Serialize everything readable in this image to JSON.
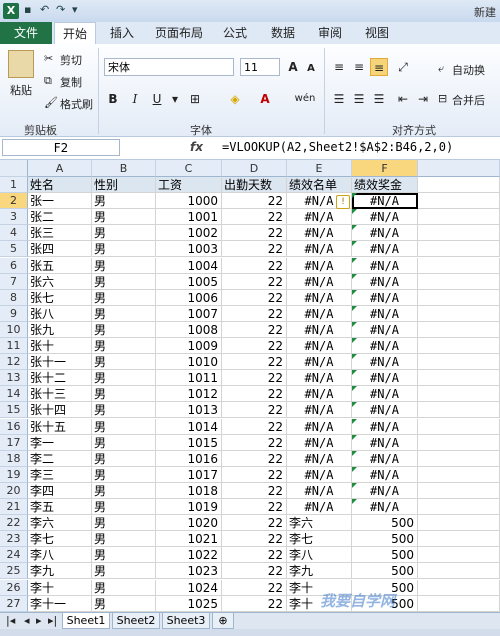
{
  "window": {
    "title_partial": "新建"
  },
  "ribbon_tabs": [
    "文件",
    "开始",
    "插入",
    "页面布局",
    "公式",
    "数据",
    "审阅",
    "视图"
  ],
  "ribbon": {
    "paste": "粘贴",
    "cut": "剪切",
    "copy": "复制",
    "format_painter": "格式刷",
    "clipboard_group": "剪贴板",
    "font_name": "宋体",
    "font_size": "11",
    "font_group": "字体",
    "wrap_text": "自动换",
    "merge": "合并后",
    "align_group": "对齐方式",
    "bold": "B",
    "italic": "I",
    "underline": "U",
    "grow_font": "A",
    "shrink_font": "A",
    "font_color": "A",
    "phonetic": "wén"
  },
  "formula_bar": {
    "name_box": "F2",
    "fx": "fx",
    "formula": "=VLOOKUP(A2,Sheet2!$A$2:B46,2,0)"
  },
  "columns": [
    "A",
    "B",
    "C",
    "D",
    "E",
    "F"
  ],
  "header_row": [
    "姓名",
    "性别",
    "工资",
    "出勤天数",
    "绩效名单",
    "绩效奖金"
  ],
  "rows": [
    [
      "张一",
      "男",
      "1000",
      "22",
      "#N/A",
      "#N/A"
    ],
    [
      "张二",
      "男",
      "1001",
      "22",
      "#N/A",
      "#N/A"
    ],
    [
      "张三",
      "男",
      "1002",
      "22",
      "#N/A",
      "#N/A"
    ],
    [
      "张四",
      "男",
      "1003",
      "22",
      "#N/A",
      "#N/A"
    ],
    [
      "张五",
      "男",
      "1004",
      "22",
      "#N/A",
      "#N/A"
    ],
    [
      "张六",
      "男",
      "1005",
      "22",
      "#N/A",
      "#N/A"
    ],
    [
      "张七",
      "男",
      "1006",
      "22",
      "#N/A",
      "#N/A"
    ],
    [
      "张八",
      "男",
      "1007",
      "22",
      "#N/A",
      "#N/A"
    ],
    [
      "张九",
      "男",
      "1008",
      "22",
      "#N/A",
      "#N/A"
    ],
    [
      "张十",
      "男",
      "1009",
      "22",
      "#N/A",
      "#N/A"
    ],
    [
      "张十一",
      "男",
      "1010",
      "22",
      "#N/A",
      "#N/A"
    ],
    [
      "张十二",
      "男",
      "1011",
      "22",
      "#N/A",
      "#N/A"
    ],
    [
      "张十三",
      "男",
      "1012",
      "22",
      "#N/A",
      "#N/A"
    ],
    [
      "张十四",
      "男",
      "1013",
      "22",
      "#N/A",
      "#N/A"
    ],
    [
      "张十五",
      "男",
      "1014",
      "22",
      "#N/A",
      "#N/A"
    ],
    [
      "李一",
      "男",
      "1015",
      "22",
      "#N/A",
      "#N/A"
    ],
    [
      "李二",
      "男",
      "1016",
      "22",
      "#N/A",
      "#N/A"
    ],
    [
      "李三",
      "男",
      "1017",
      "22",
      "#N/A",
      "#N/A"
    ],
    [
      "李四",
      "男",
      "1018",
      "22",
      "#N/A",
      "#N/A"
    ],
    [
      "李五",
      "男",
      "1019",
      "22",
      "#N/A",
      "#N/A"
    ],
    [
      "李六",
      "男",
      "1020",
      "22",
      "李六",
      "500"
    ],
    [
      "李七",
      "男",
      "1021",
      "22",
      "李七",
      "500"
    ],
    [
      "李八",
      "男",
      "1022",
      "22",
      "李八",
      "500"
    ],
    [
      "李九",
      "男",
      "1023",
      "22",
      "李九",
      "500"
    ],
    [
      "李十",
      "男",
      "1024",
      "22",
      "李十",
      "500"
    ],
    [
      "李十一",
      "男",
      "1025",
      "22",
      "李十",
      "500"
    ]
  ],
  "sheets": [
    "Sheet1",
    "Sheet2",
    "Sheet3"
  ],
  "watermark": "我要自学网"
}
